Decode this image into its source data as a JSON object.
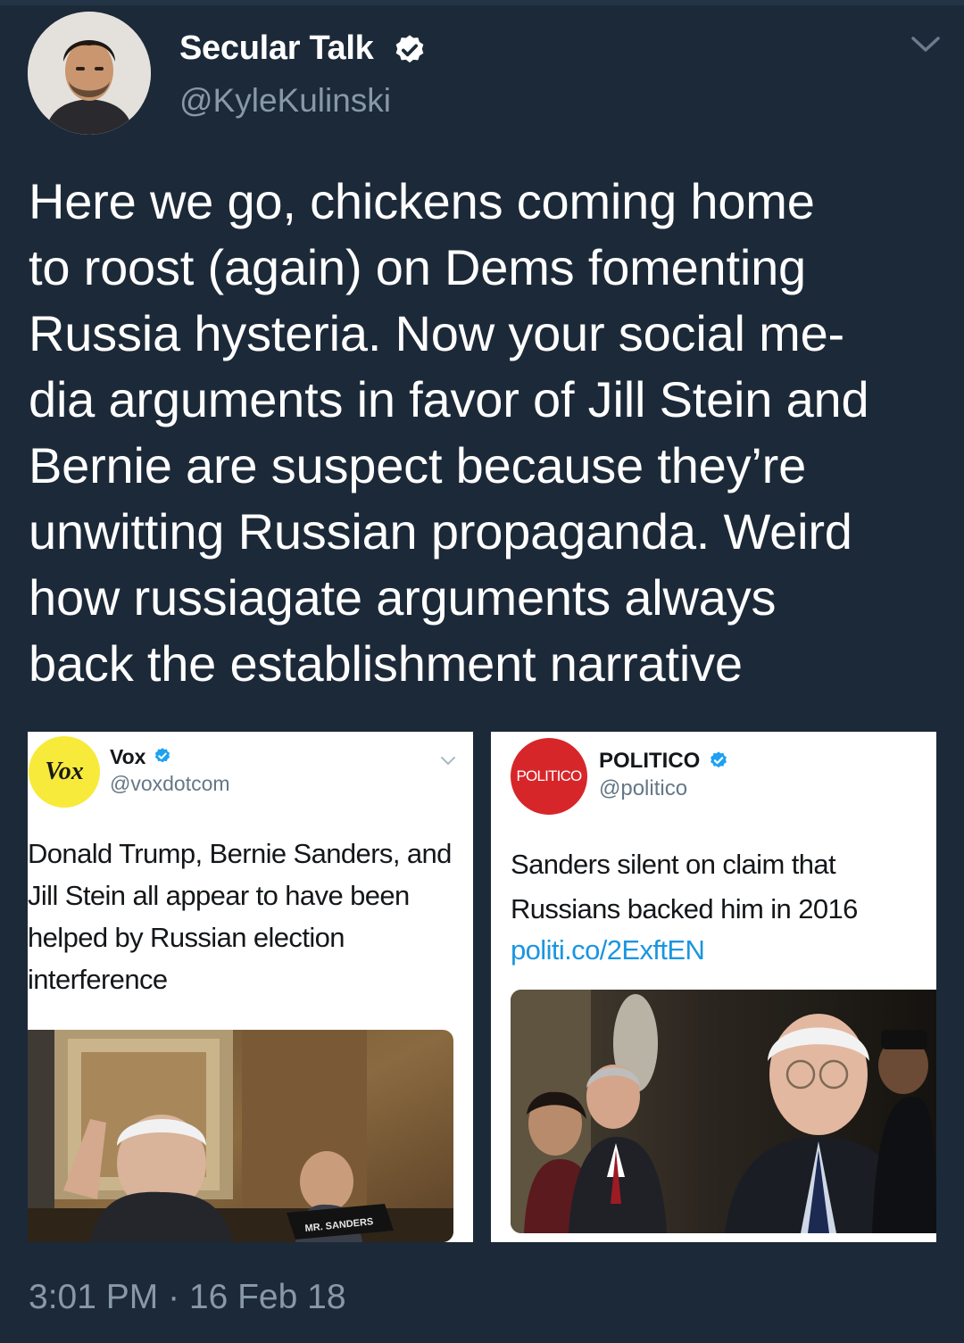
{
  "author": {
    "name": "Secular Talk",
    "handle": "@KyleKulinski"
  },
  "tweet": {
    "lines": [
      "Here we go, chickens coming home",
      "to roost (again) on Dems fomenting",
      "Russia hysteria. Now your social me-",
      "dia arguments in favor of Jill Stein and",
      "Bernie are suspect because they’re",
      "unwitting Russian propaganda. Weird",
      "how russiagate arguments always",
      "back the establishment narrative"
    ],
    "timestamp": "3:01 PM · 16 Feb 18"
  },
  "embedded": [
    {
      "logo_text": "Vox",
      "name": "Vox",
      "handle": "@voxdotcom",
      "text_lines": [
        "Donald Trump, Bernie Sanders, and",
        "Jill Stein all appear to have been",
        "helped by Russian election",
        "interference"
      ],
      "photo_placard": "MR. SANDERS"
    },
    {
      "logo_text": "POLITICO",
      "name": "POLITICO",
      "handle": "@politico",
      "text_lines": [
        "Sanders silent on claim that",
        "Russians backed him in 2016"
      ],
      "link": "politi.co/2ExftEN"
    }
  ],
  "icons": {
    "verified": "verified-badge-icon",
    "menu": "chevron-down-icon"
  },
  "colors": {
    "background": "#1c2938",
    "secondary_text": "#8899a6",
    "verified_blue": "#1da1f2",
    "link_blue": "#1b95e0",
    "vox_yellow": "#f8ea3a",
    "politico_red": "#d7262a"
  }
}
